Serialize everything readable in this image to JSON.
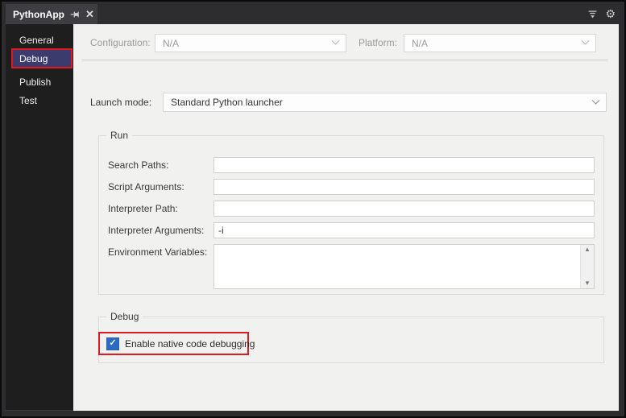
{
  "titlebar": {
    "tab_title": "PythonApp"
  },
  "sidebar": {
    "items": [
      {
        "label": "General",
        "selected": false
      },
      {
        "label": "Debug",
        "selected": true,
        "annotated": true
      },
      {
        "label": "Publish",
        "selected": false
      },
      {
        "label": "Test",
        "selected": false
      }
    ]
  },
  "config_row": {
    "configuration_label": "Configuration:",
    "configuration_value": "N/A",
    "platform_label": "Platform:",
    "platform_value": "N/A",
    "enabled": false
  },
  "launch_row": {
    "label": "Launch mode:",
    "value": "Standard Python launcher"
  },
  "run_group": {
    "title": "Run",
    "fields": [
      {
        "label": "Search Paths:",
        "value": ""
      },
      {
        "label": "Script Arguments:",
        "value": ""
      },
      {
        "label": "Interpreter Path:",
        "value": ""
      },
      {
        "label": "Interpreter Arguments:",
        "value": "-i"
      }
    ],
    "env_field": {
      "label": "Environment Variables:",
      "value": ""
    }
  },
  "debug_group": {
    "title": "Debug",
    "checkbox": {
      "label": "Enable native code debugging",
      "checked": true,
      "annotated": true
    }
  },
  "icons": {
    "gear": "⚙",
    "close": "✕",
    "check": "✓",
    "scroll_up": "▲",
    "scroll_down": "▼"
  },
  "colors": {
    "window_bg": "#2d2d30",
    "tab_bg": "#3e3e42",
    "sidebar_bg": "#1e1e1f",
    "selected_item_bg": "#3b3b6d",
    "annotation_red": "#e11a1f",
    "content_bg": "#f1f1f0",
    "checkbox_blue": "#2b6bc5",
    "disabled_text": "#9b9b9b"
  }
}
